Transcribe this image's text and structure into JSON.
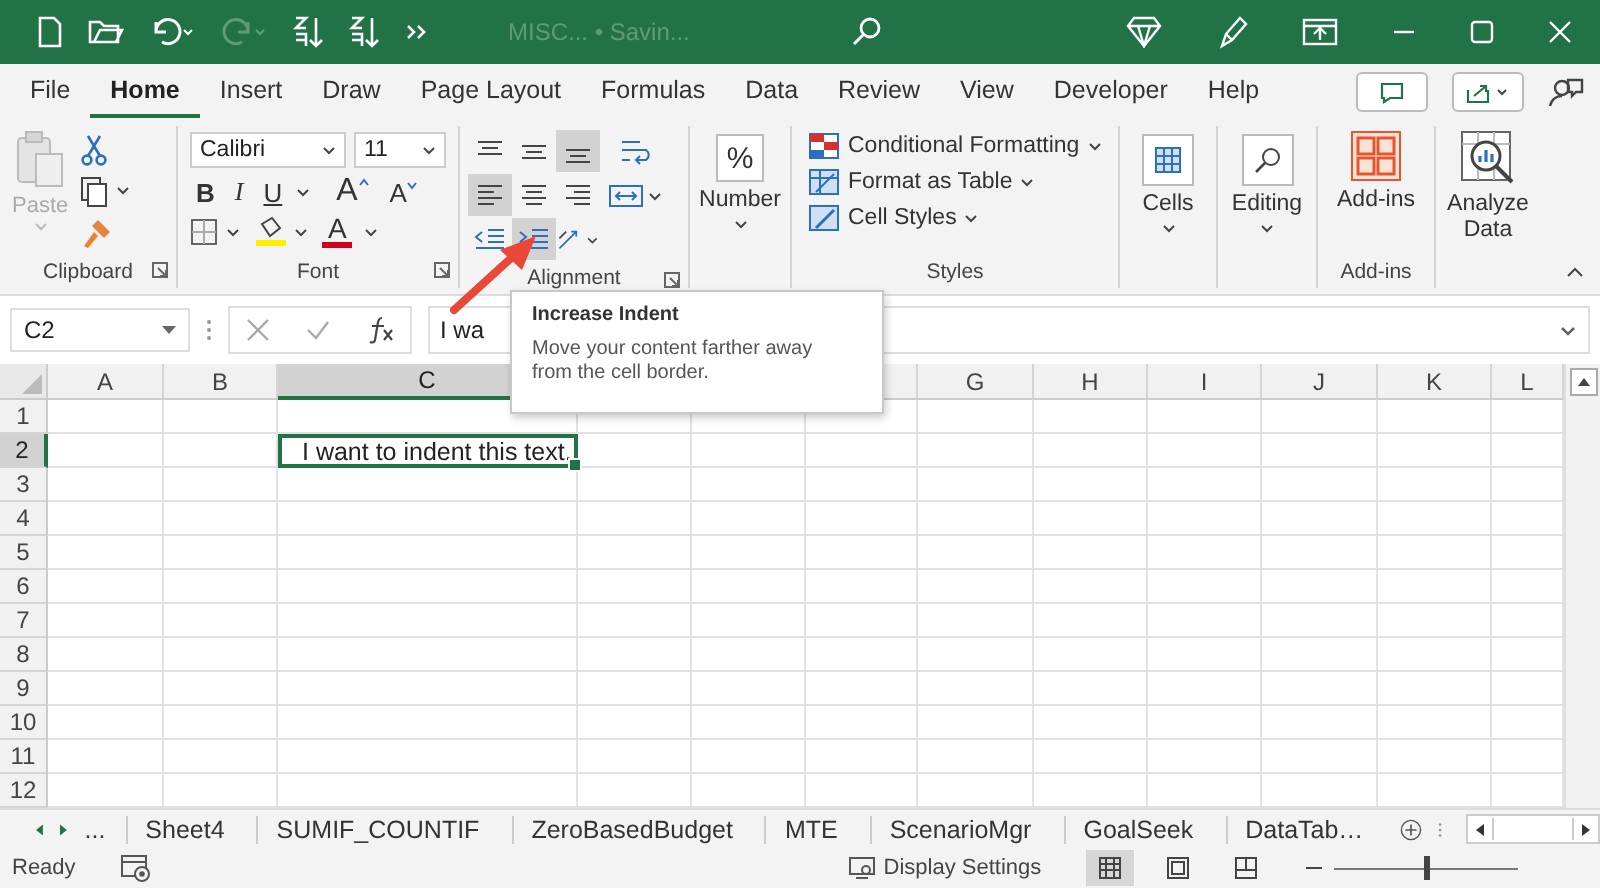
{
  "title_bar": {
    "document_title": "MISC... • Savin..."
  },
  "menu_tabs": [
    {
      "label": "File",
      "selected": false
    },
    {
      "label": "Home",
      "selected": true
    },
    {
      "label": "Insert",
      "selected": false
    },
    {
      "label": "Draw",
      "selected": false
    },
    {
      "label": "Page Layout",
      "selected": false
    },
    {
      "label": "Formulas",
      "selected": false
    },
    {
      "label": "Data",
      "selected": false
    },
    {
      "label": "Review",
      "selected": false
    },
    {
      "label": "View",
      "selected": false
    },
    {
      "label": "Developer",
      "selected": false
    },
    {
      "label": "Help",
      "selected": false
    }
  ],
  "ribbon": {
    "clipboard": {
      "paste": "Paste",
      "label": "Clipboard"
    },
    "font": {
      "font_name": "Calibri",
      "font_size": "11",
      "bold": "B",
      "italic": "I",
      "underline": "U",
      "grow": "A",
      "shrink": "A",
      "font_color": "A",
      "label": "Font"
    },
    "alignment": {
      "label": "Alignment",
      "buttons": [
        {
          "kind": "top",
          "selected": false
        },
        {
          "kind": "middle",
          "selected": false
        },
        {
          "kind": "bottom",
          "selected": true
        },
        {
          "kind": "wrap",
          "selected": false
        },
        {
          "kind": "left",
          "selected": true
        },
        {
          "kind": "center",
          "selected": false
        },
        {
          "kind": "right",
          "selected": false
        },
        {
          "kind": "merge",
          "selected": false
        },
        {
          "kind": "outdent",
          "selected": false
        },
        {
          "kind": "indent",
          "selected": true
        },
        {
          "kind": "orientation",
          "selected": false
        }
      ]
    },
    "number": {
      "glyph": "%",
      "label": "Number"
    },
    "styles": {
      "items": [
        "Conditional Formatting",
        "Format as Table",
        "Cell Styles"
      ],
      "label": "Styles"
    },
    "cells": {
      "label": "Cells"
    },
    "editing": {
      "label": "Editing"
    },
    "add_ins": {
      "button": "Add-ins",
      "label": "Add-ins"
    },
    "analyze": {
      "label": "Analyze Data"
    }
  },
  "formula_bar": {
    "name_box": "C2",
    "value": "I wa"
  },
  "tooltip": {
    "title": "Increase Indent",
    "text": "Move your content farther away from the cell border."
  },
  "grid": {
    "columns": [
      {
        "label": "A",
        "selected": false
      },
      {
        "label": "B",
        "selected": false
      },
      {
        "label": "C",
        "selected": true
      },
      {
        "label": "G",
        "selected": false
      },
      {
        "label": "H",
        "selected": false
      },
      {
        "label": "I",
        "selected": false
      },
      {
        "label": "J",
        "selected": false
      },
      {
        "label": "K",
        "selected": false
      },
      {
        "label": "L",
        "selected": false
      }
    ],
    "rows": [
      {
        "label": "1",
        "selected": false
      },
      {
        "label": "2",
        "selected": true
      },
      {
        "label": "3",
        "selected": false
      },
      {
        "label": "4",
        "selected": false
      },
      {
        "label": "5",
        "selected": false
      },
      {
        "label": "6",
        "selected": false
      },
      {
        "label": "7",
        "selected": false
      },
      {
        "label": "8",
        "selected": false
      },
      {
        "label": "9",
        "selected": false
      },
      {
        "label": "10",
        "selected": false
      },
      {
        "label": "11",
        "selected": false
      },
      {
        "label": "12",
        "selected": false
      }
    ],
    "active_cell": {
      "text": "I want to indent this text."
    }
  },
  "sheet_tabs": {
    "overflow": "...",
    "tabs": [
      "Sheet4",
      "SUMIF_COUNTIF",
      "ZeroBasedBudget",
      "MTE",
      "ScenarioMgr",
      "GoalSeek",
      "DataTab…"
    ]
  },
  "status_bar": {
    "state": "Ready",
    "display_settings": "Display Settings",
    "zoom": {
      "level": 0.5
    }
  }
}
